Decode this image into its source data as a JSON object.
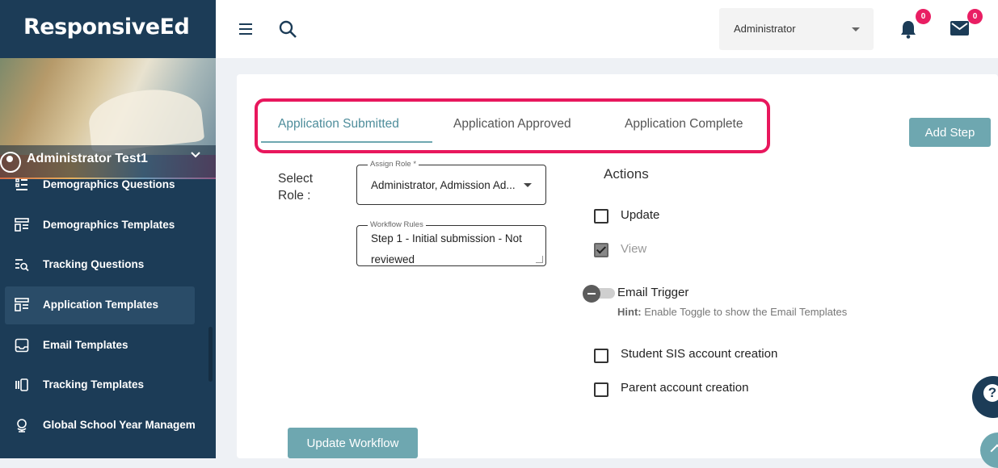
{
  "sidebar": {
    "brand": "ResponsiveEd",
    "user_name": "Administrator Test1",
    "items": [
      {
        "label": "Demographics Questions",
        "icon": "list-numbered-icon"
      },
      {
        "label": "Demographics Templates",
        "icon": "template-icon"
      },
      {
        "label": "Tracking Questions",
        "icon": "search-list-icon"
      },
      {
        "label": "Application Templates",
        "icon": "template-icon",
        "active": true
      },
      {
        "label": "Email Templates",
        "icon": "inbox-icon"
      },
      {
        "label": "Tracking Templates",
        "icon": "columns-icon"
      },
      {
        "label": "Global School Year Managem",
        "icon": "globe-icon"
      }
    ]
  },
  "topbar": {
    "role_value": "Administrator",
    "notifications_count": "0",
    "messages_count": "0"
  },
  "tabs": [
    {
      "label": "Application Submitted",
      "active": true
    },
    {
      "label": "Application Approved",
      "active": false
    },
    {
      "label": "Application Complete",
      "active": false
    }
  ],
  "add_step_label": "Add Step",
  "form": {
    "select_role_label": "Select Role :",
    "assign_role_legend": "Assign Role *",
    "assign_role_value": "Administrator, Admission Ad...",
    "workflow_rules_legend": "Workflow Rules",
    "workflow_rules_value": "Step 1 - Initial submission - Not reviewed"
  },
  "actions": {
    "title": "Actions",
    "update_label": "Update",
    "view_label": "View",
    "email_trigger_label": "Email Trigger",
    "hint_prefix": "Hint:",
    "hint_text": "Enable Toggle to show the Email Templates",
    "sis_label": "Student SIS account creation",
    "parent_label": "Parent account creation"
  },
  "update_workflow_label": "Update Workflow",
  "colors": {
    "sidebar": "#1c3c57",
    "accent": "#6ea7b0",
    "highlight": "#e8175d",
    "badge": "#e91e63"
  }
}
